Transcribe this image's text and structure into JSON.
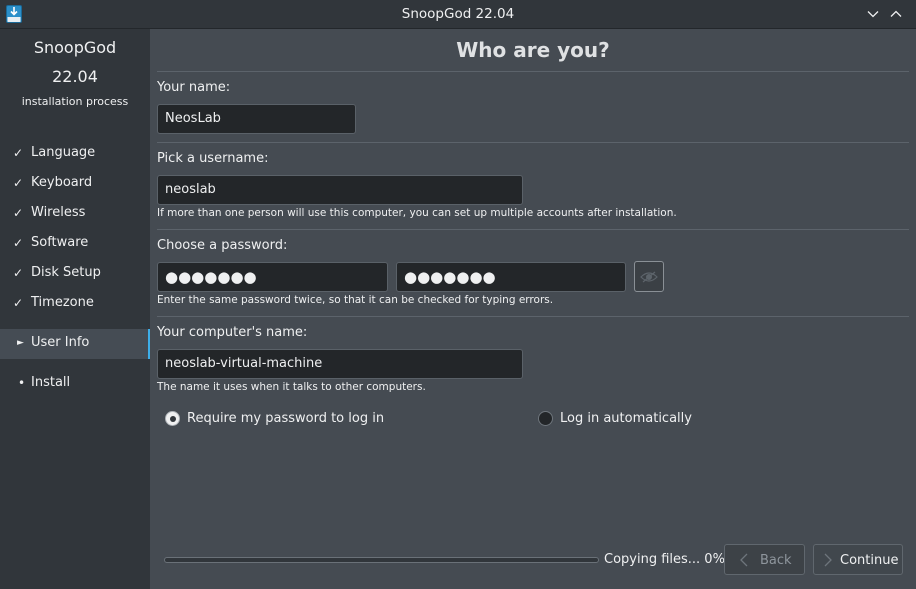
{
  "window": {
    "title": "SnoopGod 22.04"
  },
  "sidebar": {
    "brand_name": "SnoopGod",
    "brand_version": "22.04",
    "brand_subtitle": "installation process",
    "steps": [
      {
        "mark": "✓",
        "label": "Language"
      },
      {
        "mark": "✓",
        "label": "Keyboard"
      },
      {
        "mark": "✓",
        "label": "Wireless"
      },
      {
        "mark": "✓",
        "label": "Software"
      },
      {
        "mark": "✓",
        "label": "Disk Setup"
      },
      {
        "mark": "✓",
        "label": "Timezone"
      },
      {
        "mark": "►",
        "label": "User Info"
      },
      {
        "mark": "•",
        "label": "Install"
      }
    ]
  },
  "main": {
    "title": "Who are you?",
    "name_label": "Your name:",
    "name_value": "NeosLab",
    "username_label": "Pick a username:",
    "username_value": "neoslab",
    "username_hint": "If more than one person will use this computer, you can set up multiple accounts after installation.",
    "password_label": "Choose a password:",
    "password_value": "●●●●●●●",
    "password_confirm_value": "●●●●●●●",
    "password_hint": "Enter the same password twice, so that it can be checked for typing errors.",
    "computer_label": "Your computer's name:",
    "computer_value": "neoslab-virtual-machine",
    "computer_hint": "The name it uses when it talks to other computers.",
    "radio_require": "Require my password to log in",
    "radio_auto": "Log in automatically",
    "selected_login_option": "Require my password to log in"
  },
  "footer": {
    "progress_text": "Copying files... 0%",
    "progress_fraction": 0,
    "back_label": "Back",
    "continue_label": "Continue"
  },
  "colors": {
    "accent": "#3daee9",
    "sidebar_bg": "#31363b",
    "main_bg": "#454b52",
    "input_bg": "#232629"
  },
  "icons": {
    "app": "installer-download-icon",
    "minimize": "chevron-down-icon",
    "maximize": "chevron-up-icon",
    "eye": "eye-toggle-icon",
    "back": "chevron-left-icon",
    "continue": "chevron-right-icon"
  }
}
